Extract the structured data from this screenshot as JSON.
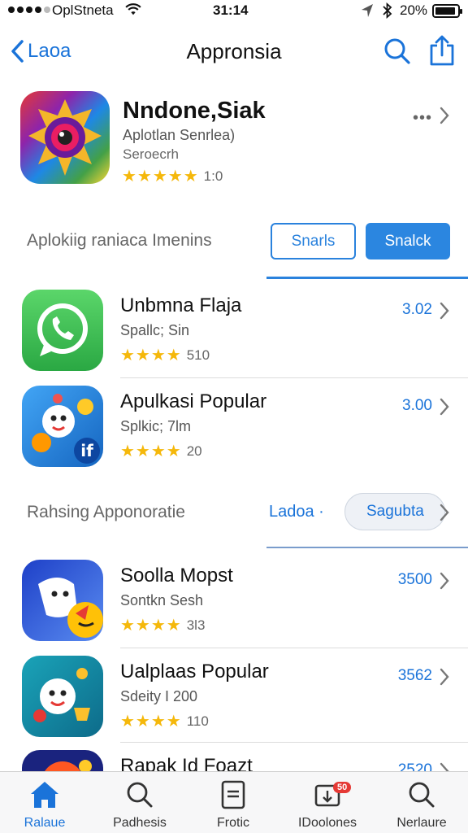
{
  "status_bar": {
    "carrier": "OplStneta",
    "time": "31:14",
    "battery": "20%"
  },
  "nav": {
    "back_label": "Laoa",
    "title": "Appronsia"
  },
  "featured": {
    "name": "Nndone,Siak",
    "subtitle": "Aplotlan Senrlea)",
    "category": "Seroecrh",
    "stars": "★★★★★",
    "rating": "1:0"
  },
  "section1": {
    "label": "Aplokiig raniaca  Imenins",
    "outline_button": "Snarls",
    "solid_button": "Snalck"
  },
  "list1": [
    {
      "name": "Unbmna Flaja",
      "sub": "Spallc; Sin",
      "stars": "★★★★",
      "rating": "510",
      "price": "3.02"
    },
    {
      "name": "Apulkasi Popular",
      "sub": "Splkic; 7lm",
      "stars": "★★★★",
      "rating": "20",
      "price": "3.00"
    }
  ],
  "section2": {
    "label": "Rahsing Apponoratie",
    "link": "Ladoa ·",
    "pill": "Sagubta"
  },
  "list2": [
    {
      "name": "Soolla Mopst",
      "sub": "Sontkn Sesh",
      "stars": "★★★★",
      "rating": "3l3",
      "price": "3500"
    },
    {
      "name": "Ualplaas Popular",
      "sub": "Sdeity I 200",
      "stars": "★★★★",
      "rating": "110",
      "price": "3562"
    },
    {
      "name": "Rapak Id Foazt",
      "price": "2520"
    }
  ],
  "tabbar": {
    "tabs": [
      {
        "label": "Ralaue",
        "icon": "home-icon"
      },
      {
        "label": "Padhesis",
        "icon": "search-icon"
      },
      {
        "label": "Frotic",
        "icon": "document-icon"
      },
      {
        "label": "IDoolones",
        "icon": "updates-icon",
        "badge": "50"
      },
      {
        "label": "Nerlaure",
        "icon": "search-icon"
      }
    ]
  },
  "colors": {
    "accent": "#1a73d9",
    "star": "#f5b80b",
    "button": "#2b86e0"
  }
}
